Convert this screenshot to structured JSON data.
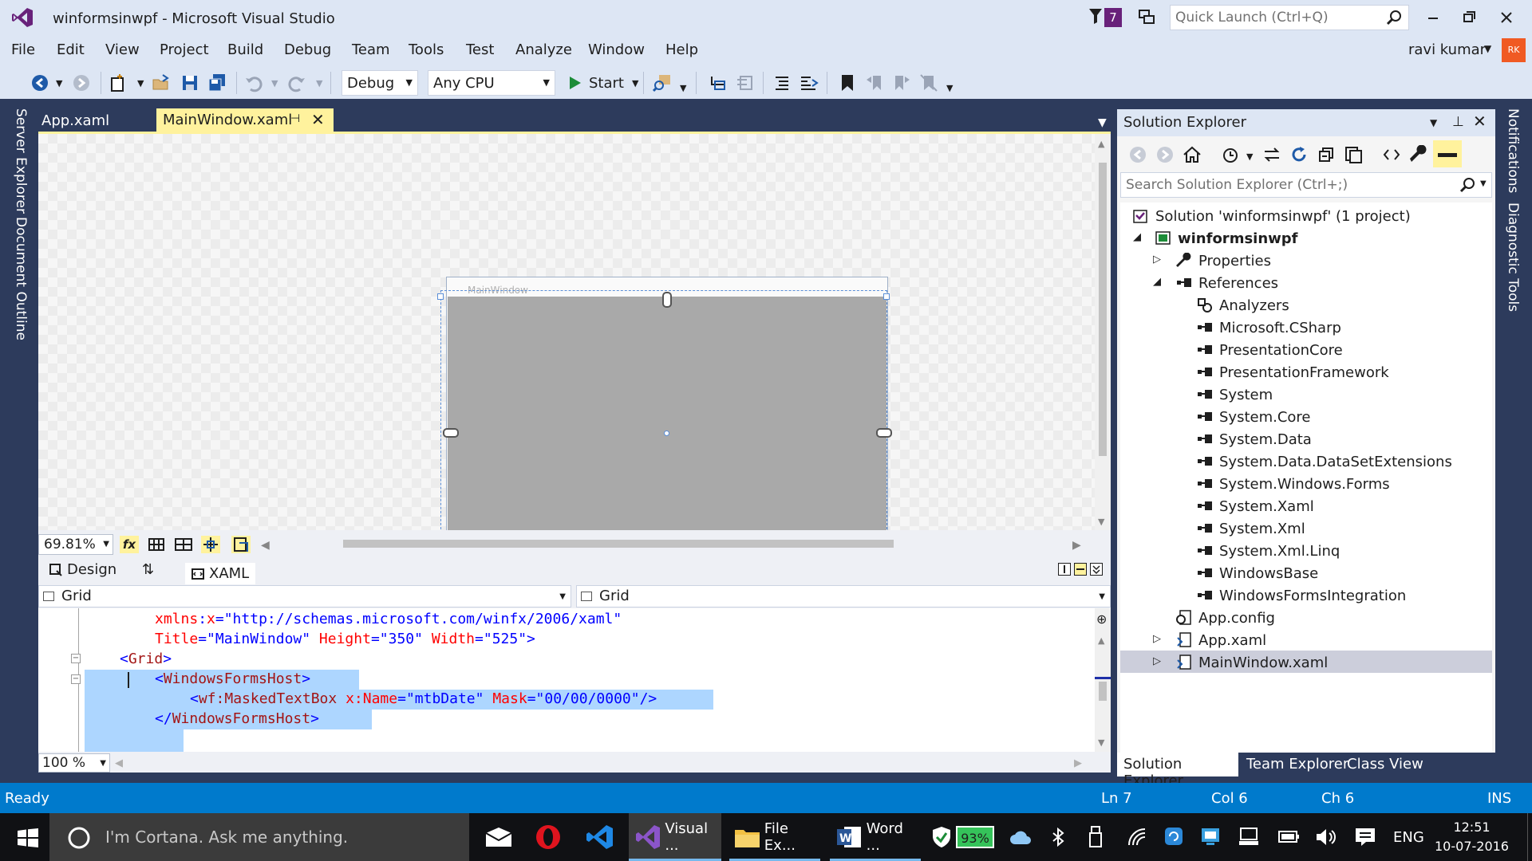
{
  "window": {
    "title": "winformsinwpf - Microsoft Visual Studio",
    "notification_count": "7",
    "quick_launch_placeholder": "Quick Launch (Ctrl+Q)",
    "user_name": "ravi kumar",
    "avatar_initials": "RK"
  },
  "menu": [
    "File",
    "Edit",
    "View",
    "Project",
    "Build",
    "Debug",
    "Team",
    "Tools",
    "Test",
    "Analyze",
    "Window",
    "Help"
  ],
  "toolbar": {
    "configuration": "Debug",
    "platform": "Any CPU",
    "start_label": "Start"
  },
  "left_rail": [
    "Server Explorer",
    "Document Outline"
  ],
  "right_rail": [
    "Notifications",
    "Diagnostic Tools"
  ],
  "doc_tabs": {
    "tab1": "App.xaml",
    "tab2": "MainWindow.xaml"
  },
  "designer": {
    "window_caption": "MainWindow",
    "zoom": "69.81%",
    "fx_label": "fx",
    "design_tab": "Design",
    "xaml_tab": "XAML"
  },
  "navbar": {
    "left": "Grid",
    "right": "Grid"
  },
  "code": {
    "l1_attr_prefix": "xmlns",
    "l1_colon": ":",
    "l1_attr": "x",
    "l1_eq": "=",
    "l1_val": "\"http://schemas.microsoft.com/winfx/2006/xaml\"",
    "l2_a1": "Title",
    "l2_v1": "\"MainWindow\"",
    "l2_a2": "Height",
    "l2_v2": "\"350\"",
    "l2_a3": "Width",
    "l2_v3": "\"525\"",
    "l2_end": ">",
    "l3_open": "<",
    "l3_tag": "Grid",
    "l3_close": ">",
    "l4_open": "<",
    "l4_tag": "WindowsFormsHost",
    "l4_close": ">",
    "l5_open": "<",
    "l5_tag": "wf:MaskedTextBox",
    "l5_a1": "x:Name",
    "l5_v1": "\"mtbDate\"",
    "l5_a2": "Mask",
    "l5_v2": "\"00/00/0000\"",
    "l5_close": "/>",
    "l6_open": "</",
    "l6_tag": "WindowsFormsHost",
    "l6_close": ">",
    "eq": "=",
    "zoom": "100 %"
  },
  "solution_explorer": {
    "title": "Solution Explorer",
    "search_placeholder": "Search Solution Explorer (Ctrl+;)",
    "solution": "Solution 'winformsinwpf' (1 project)",
    "project": "winformsinwpf",
    "properties": "Properties",
    "references": "References",
    "refs": [
      "Analyzers",
      "Microsoft.CSharp",
      "PresentationCore",
      "PresentationFramework",
      "System",
      "System.Core",
      "System.Data",
      "System.Data.DataSetExtensions",
      "System.Windows.Forms",
      "System.Xaml",
      "System.Xml",
      "System.Xml.Linq",
      "WindowsBase",
      "WindowsFormsIntegration"
    ],
    "app_config": "App.config",
    "app_xaml": "App.xaml",
    "main_window": "MainWindow.xaml",
    "tabs": [
      "Solution Explorer",
      "Team Explorer",
      "Class View"
    ]
  },
  "status": {
    "text": "Ready",
    "ln": "Ln 7",
    "col": "Col 6",
    "ch": "Ch 6",
    "mode": "INS"
  },
  "taskbar": {
    "cortana_placeholder": "I'm Cortana. Ask me anything.",
    "app_vs": "Visual ...",
    "app_explorer": "File Ex...",
    "app_word": "Word ...",
    "battery": "93%",
    "lang": "ENG",
    "time": "12:51",
    "date": "10-07-2016"
  },
  "colors": {
    "vs_purple": "#68217a",
    "status_blue": "#007acc",
    "tab_yellow": "#fff29d",
    "chrome": "#dde6f4"
  }
}
